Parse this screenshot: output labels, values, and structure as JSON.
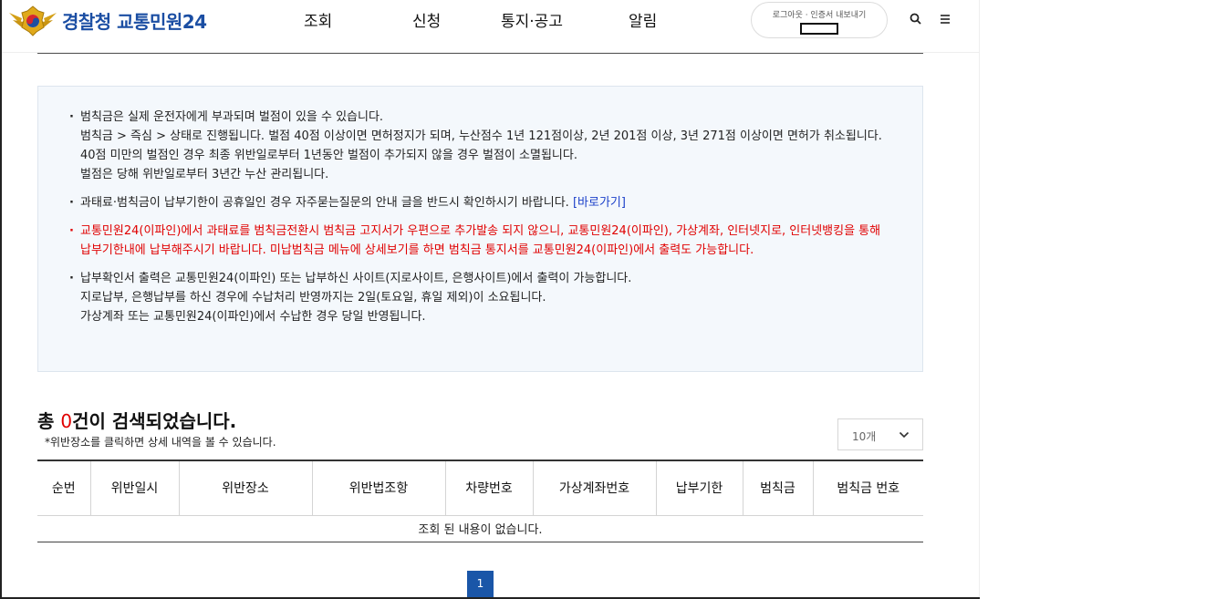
{
  "header": {
    "logo_text": "경찰청 교통민원24",
    "nav": [
      "조회",
      "신청",
      "통지·공고",
      "알림"
    ],
    "login_links": "로그아웃 · 인증서 내보내기",
    "search_icon": "search-icon",
    "menu_icon": "hamburger-menu-icon"
  },
  "notice": {
    "item1": {
      "line1": "범칙금은 실제 운전자에게 부과되며 벌점이 있을 수 있습니다.",
      "line2": "범칙금 > 즉심 > 상태로 진행됩니다. 벌점 40점 이상이면 면허정지가 되며, 누산점수 1년 121점이상, 2년 201점 이상, 3년 271점 이상이면 면허가 취소됩니다.",
      "line3": "40점 미만의 벌점인 경우 최종 위반일로부터 1년동안 벌점이 추가되지 않을 경우 벌점이 소멸됩니다.",
      "line4": "벌점은 당해 위반일로부터 3년간 누산 관리됩니다."
    },
    "item2": {
      "text": "과태료·범칙금이 납부기한이 공휴일인 경우 자주묻는질문의 안내 글을 반드시 확인하시기 바랍니다.",
      "link": "[바로가기]"
    },
    "item3": {
      "text": "교통민원24(이파인)에서 과태료를 범칙금전환시 범칙금 고지서가 우편으로 추가발송 되지 않으니, 교통민원24(이파인), 가상계좌, 인터넷지로, 인터넷뱅킹을 통해 납부기한내에 납부해주시기 바랍니다. 미납범칙금 메뉴에 상세보기를 하면 범칙금 통지서를 교통민원24(이파인)에서 출력도 가능합니다."
    },
    "item4": {
      "line1": "납부확인서 출력은 교통민원24(이파인) 또는 납부하신 사이트(지로사이트, 은행사이트)에서 출력이 가능합니다.",
      "line2": "지로납부, 은행납부를 하신 경우에 수납처리 반영까지는 2일(토요일, 휴일 제외)이 소요됩니다.",
      "line3": "가상계좌 또는 교통민원24(이파인)에서 수납한 경우 당일 반영됩니다."
    }
  },
  "results": {
    "title_prefix": "총 ",
    "count": "0",
    "title_suffix": "건이 검색되었습니다.",
    "hint": "*위반장소를 클릭하면 상세 내역을 볼 수 있습니다.",
    "page_size": "10개",
    "columns": [
      "순번",
      "위반일시",
      "위반장소",
      "위반법조항",
      "차량번호",
      "가상계좌번호",
      "납부기한",
      "범칙금",
      "범칙금 번호"
    ],
    "empty_message": "조회 된 내용이 없습니다."
  },
  "pagination": {
    "current": "1"
  },
  "colors": {
    "brand_blue": "#1b4ea3",
    "alert_red": "#e00000",
    "link_blue": "#1a3fc9",
    "pager_blue": "#1a56a8"
  }
}
